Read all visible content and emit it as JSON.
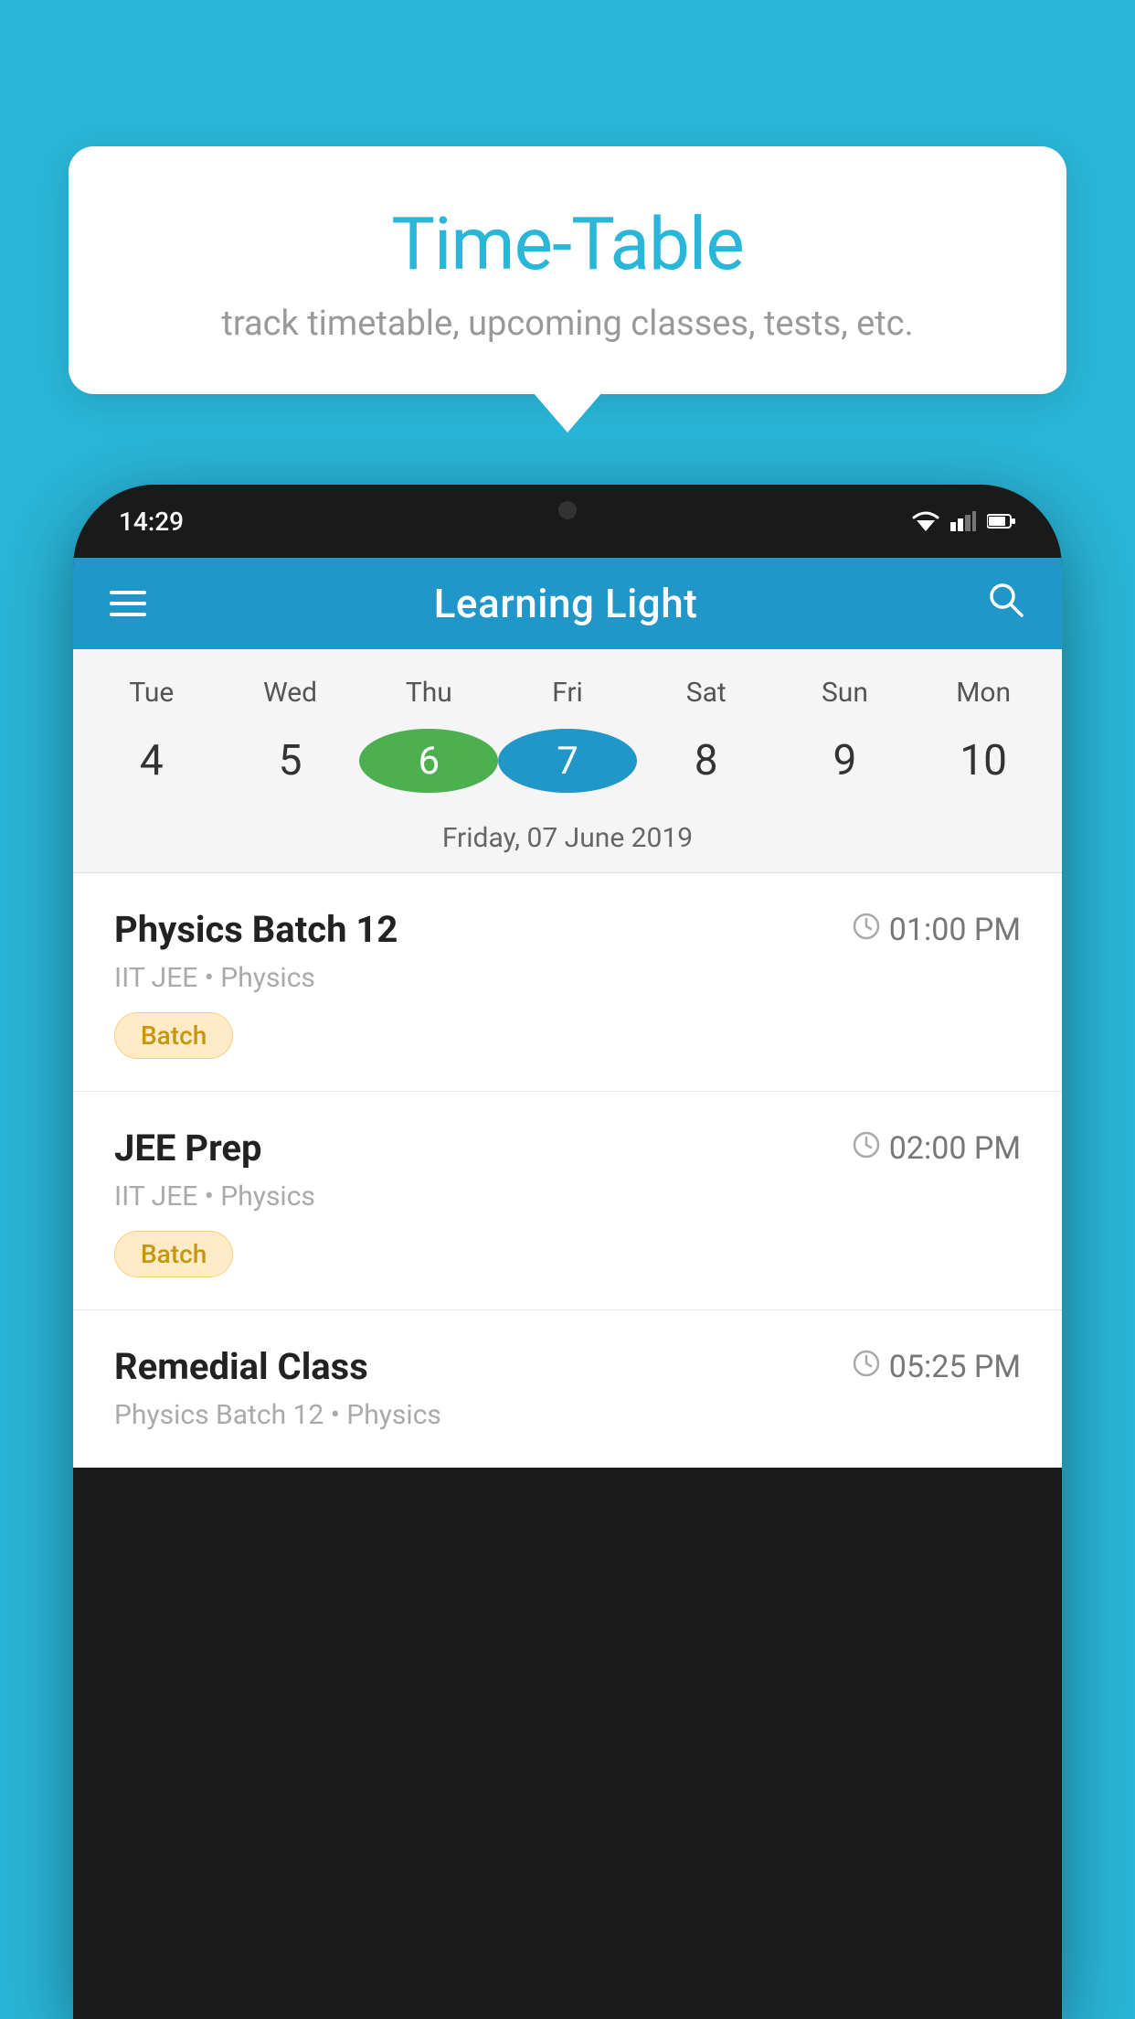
{
  "background": {
    "color": "#29b6d8"
  },
  "tooltip": {
    "title": "Time-Table",
    "subtitle": "track timetable, upcoming classes, tests, etc."
  },
  "phone": {
    "status_bar": {
      "time": "14:29"
    },
    "app_header": {
      "title": "Learning Light"
    },
    "calendar": {
      "days": [
        {
          "label": "Tue",
          "number": "4"
        },
        {
          "label": "Wed",
          "number": "5"
        },
        {
          "label": "Thu",
          "number": "6",
          "state": "today"
        },
        {
          "label": "Fri",
          "number": "7",
          "state": "selected"
        },
        {
          "label": "Sat",
          "number": "8"
        },
        {
          "label": "Sun",
          "number": "9"
        },
        {
          "label": "Mon",
          "number": "10"
        }
      ],
      "selected_date_label": "Friday, 07 June 2019"
    },
    "schedule": [
      {
        "name": "Physics Batch 12",
        "time": "01:00 PM",
        "sub": "IIT JEE • Physics",
        "badge": "Batch"
      },
      {
        "name": "JEE Prep",
        "time": "02:00 PM",
        "sub": "IIT JEE • Physics",
        "badge": "Batch"
      },
      {
        "name": "Remedial Class",
        "time": "05:25 PM",
        "sub": "Physics Batch 12 • Physics",
        "badge": null
      }
    ]
  }
}
